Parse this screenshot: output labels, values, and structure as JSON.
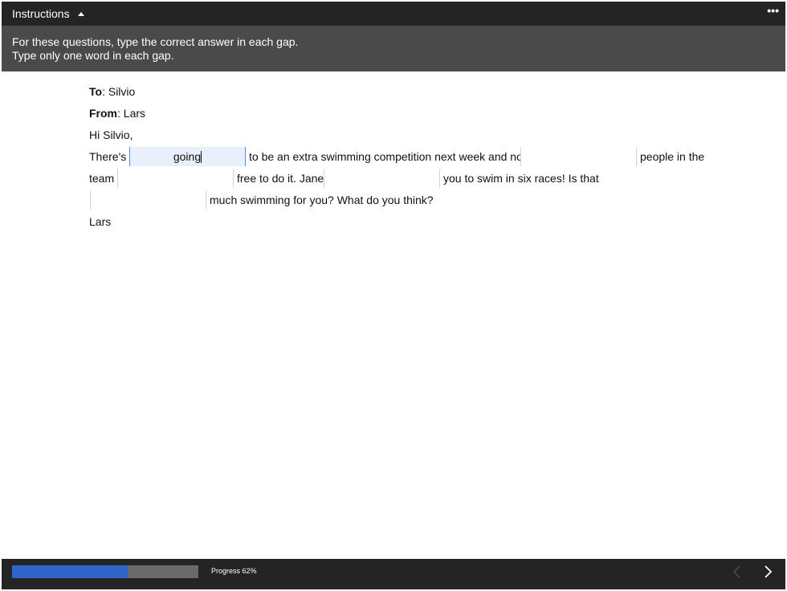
{
  "header": {
    "instructions_label": "Instructions",
    "caret_icon": "caret-up-icon",
    "more_label": "•••"
  },
  "instructions": {
    "line1": "For these questions, type the correct answer in each gap.",
    "line2": "Type only one word in each gap."
  },
  "email": {
    "to_label": "To",
    "to_value": ": Silvio",
    "from_label": "From",
    "from_value": ": Lars",
    "greeting": "Hi Silvio,",
    "p1_a": "There's",
    "p1_b": "to be an extra swimming competition next week and not",
    "p1_c": "people in the",
    "p2_a": "team",
    "p2_b": "free to do it. Jane",
    "p2_c": "you to swim in six races! Is that",
    "p3_a": "much swimming for you? What do you think?",
    "signoff": "Lars"
  },
  "gaps": [
    {
      "value": "going",
      "active": true
    },
    {
      "value": "",
      "active": false
    },
    {
      "value": "",
      "active": false
    },
    {
      "value": "",
      "active": false
    },
    {
      "value": "",
      "active": false
    }
  ],
  "footer": {
    "progress_percent": 62,
    "progress_label": "Progress 62%",
    "prev_icon": "chevron-left-icon",
    "next_icon": "chevron-right-icon"
  },
  "colors": {
    "topbar": "#242424",
    "instructions_panel": "#4a4a4a",
    "progress_fill": "#2f65c9",
    "progress_track": "#6a6a6a",
    "active_gap": "#e8f0fc"
  }
}
